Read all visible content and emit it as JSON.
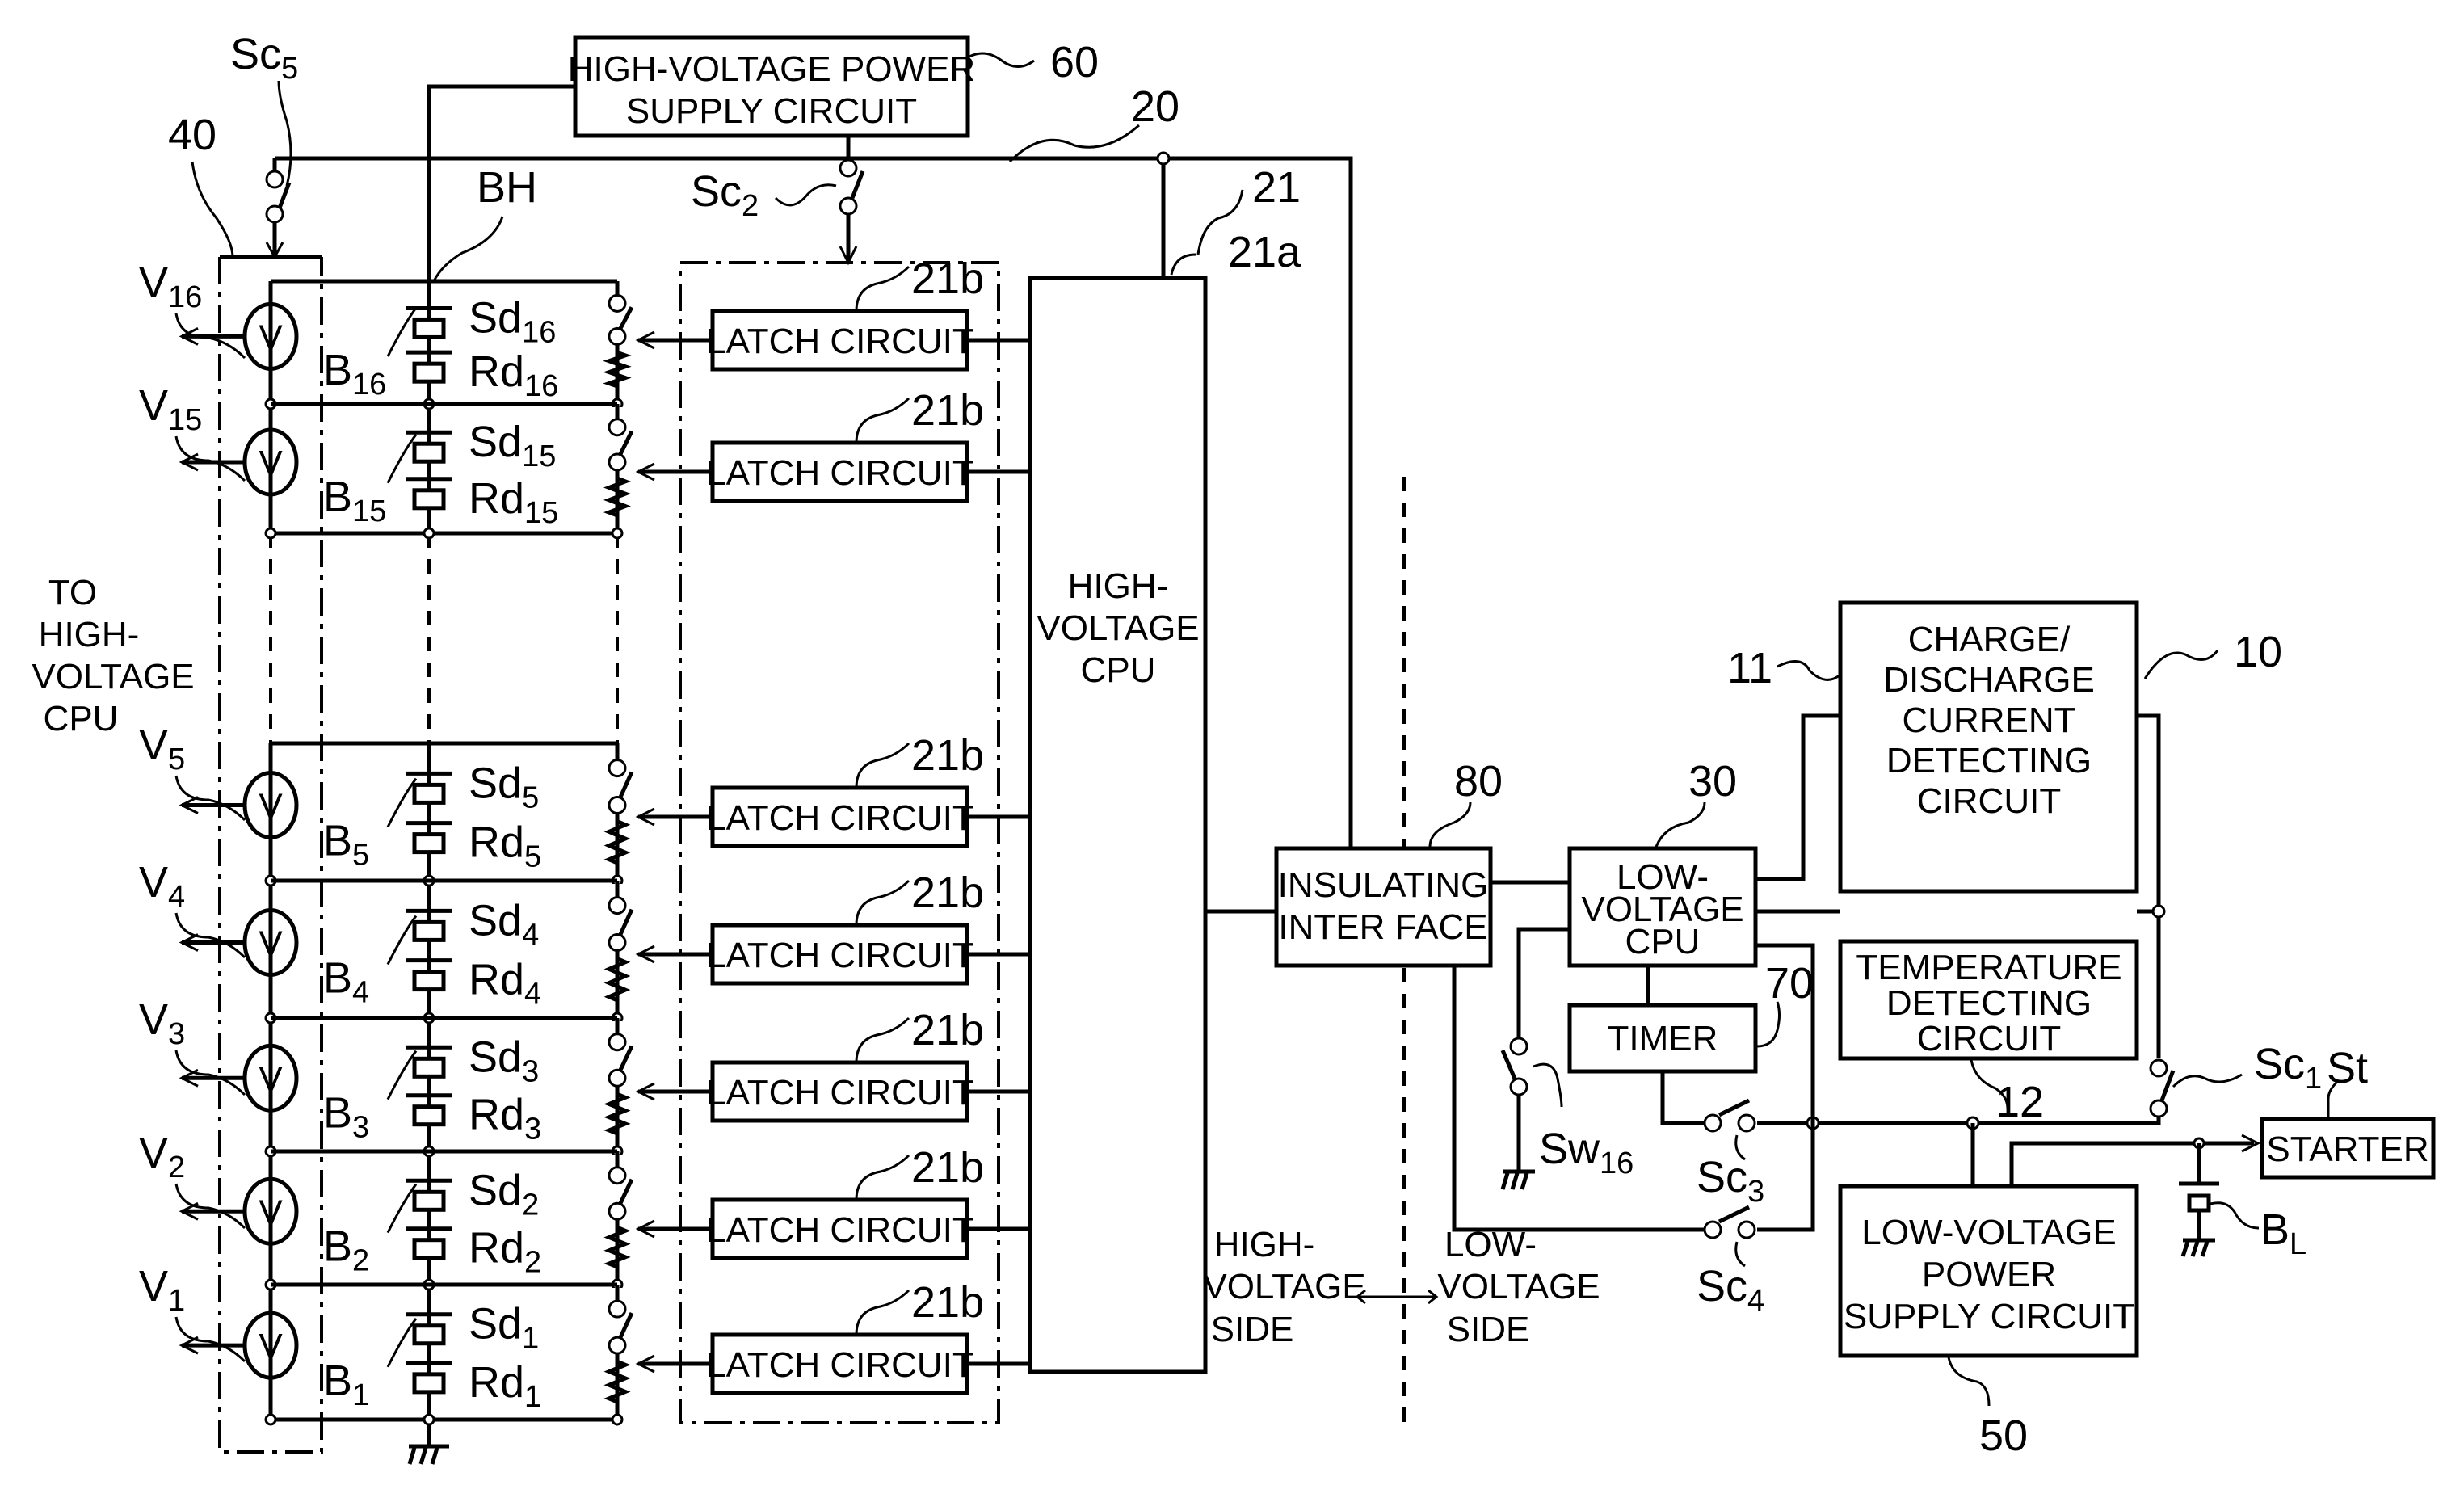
{
  "figure": {
    "blocks": {
      "hv_power_supply": {
        "lines": [
          "HIGH-VOLTAGE POWER",
          "SUPPLY CIRCUIT"
        ],
        "ref": "60"
      },
      "hv_cpu": {
        "lines": [
          "HIGH-",
          "VOLTAGE",
          "CPU"
        ],
        "ref": "21a"
      },
      "latch_circuit": {
        "label": "LATCH CIRCUIT",
        "ref": "21b"
      },
      "insulating_interface": {
        "lines": [
          "INSULATING",
          "INTER FACE"
        ],
        "ref": "80"
      },
      "lv_cpu": {
        "lines": [
          "LOW-",
          "VOLTAGE",
          "CPU"
        ],
        "ref": "30"
      },
      "timer": {
        "label": "TIMER",
        "ref": "70"
      },
      "charge_discharge": {
        "lines": [
          "CHARGE/",
          "DISCHARGE",
          "CURRENT",
          "DETECTING",
          "CIRCUIT"
        ],
        "ref": "11"
      },
      "temperature": {
        "lines": [
          "TEMPERATURE",
          "DETECTING",
          "CIRCUIT"
        ],
        "ref": "12"
      },
      "lv_power_supply": {
        "lines": [
          "LOW-VOLTAGE",
          "POWER",
          "SUPPLY CIRCUIT"
        ],
        "ref": "50"
      },
      "starter": {
        "label": "STARTER",
        "ref": "St"
      }
    },
    "refs": {
      "system": "10",
      "hv_system": "20",
      "hv_controller": "21",
      "voltmeter_group": "40",
      "battery_pack": "BH",
      "lv_battery": "B",
      "lv_battery_sub": "L"
    },
    "switches": {
      "sc1": {
        "base": "Sc",
        "sub": "1"
      },
      "sc2": {
        "base": "Sc",
        "sub": "2"
      },
      "sc3": {
        "base": "Sc",
        "sub": "3"
      },
      "sc4": {
        "base": "Sc",
        "sub": "4"
      },
      "sc5": {
        "base": "Sc",
        "sub": "5"
      },
      "sw16": {
        "base": "Sw",
        "sub": "16"
      }
    },
    "side_labels": {
      "to_hv_cpu": [
        "TO",
        "HIGH-",
        "VOLTAGE",
        "CPU"
      ],
      "high_side": [
        "HIGH-",
        "VOLTAGE",
        "SIDE"
      ],
      "low_side": [
        "LOW-",
        "VOLTAGE",
        "SIDE"
      ]
    },
    "cells": [
      {
        "n": "16"
      },
      {
        "n": "15"
      },
      {
        "n": "5"
      },
      {
        "n": "4"
      },
      {
        "n": "3"
      },
      {
        "n": "2"
      },
      {
        "n": "1"
      }
    ],
    "cell_prefixes": {
      "voltmeter": "V",
      "battery": "B",
      "switch": "Sd",
      "resistor": "Rd",
      "meter_glyph": "V"
    }
  }
}
